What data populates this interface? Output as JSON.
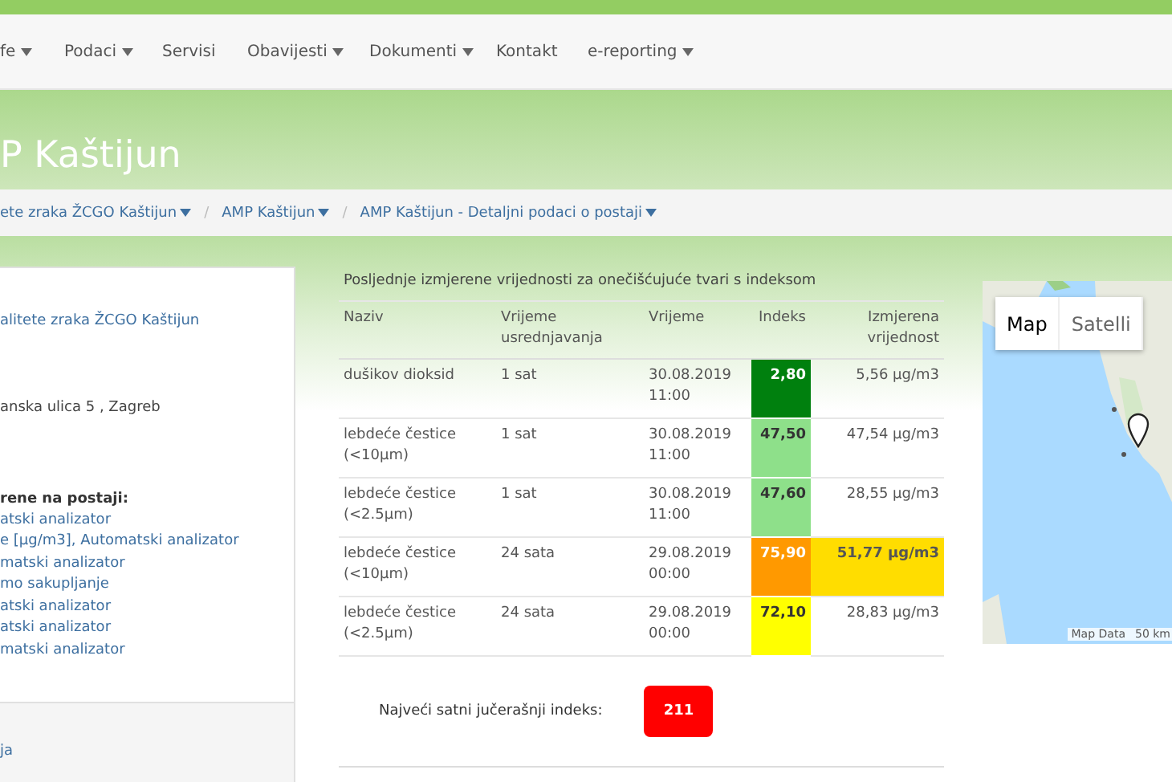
{
  "nav": [
    {
      "label": "fe",
      "dropdown": true
    },
    {
      "label": "Podaci",
      "dropdown": true
    },
    {
      "label": "Servisi",
      "dropdown": false
    },
    {
      "label": "Obavijesti",
      "dropdown": true
    },
    {
      "label": "Dokumenti",
      "dropdown": true
    },
    {
      "label": "Kontakt",
      "dropdown": false
    },
    {
      "label": "e-reporting",
      "dropdown": true
    }
  ],
  "page_title": "P Kaštijun",
  "breadcrumb": [
    {
      "label": "ete zraka ŽCGO Kaštijun"
    },
    {
      "label": "AMP Kaštijun"
    },
    {
      "label": "AMP Kaštijun - Detaljni podaci o postaji"
    }
  ],
  "breadcrumb_separator": "/",
  "info": {
    "network_link": "alitete zraka ŽCGO Kaštijun",
    "address": "anska ulica 5 , Zagreb",
    "measured_heading": "rene na postaji:",
    "measured_items": [
      "atski analizator",
      "e [µg/m3], Automatski analizator",
      "matski analizator",
      "mo sakupljanje",
      "atski analizator",
      "atski analizator",
      "matski analizator"
    ],
    "footer_link": "ja"
  },
  "table": {
    "caption": "Posljednje izmjerene vrijednosti za onečišćujuće tvari s indeksom",
    "columns": [
      "Naziv",
      "Vrijeme usrednjavanja",
      "Vrijeme",
      "Indeks",
      "Izmjerena vrijednost"
    ],
    "rows": [
      {
        "name": "dušikov dioksid",
        "averaging": "1 sat",
        "time": "30.08.2019 11:00",
        "index": "2,80",
        "color": "#00800e",
        "value": "5,56 µg/m3",
        "highlighted": false
      },
      {
        "name": "lebdeće čestice (<10µm)",
        "averaging": "1 sat",
        "time": "30.08.2019 11:00",
        "index": "47,50",
        "color": "#8ee08a",
        "value": "47,54 µg/m3",
        "highlighted": false
      },
      {
        "name": "lebdeće čestice (<2.5µm)",
        "averaging": "1 sat",
        "time": "30.08.2019 11:00",
        "index": "47,60",
        "color": "#8ee08a",
        "value": "28,55 µg/m3",
        "highlighted": false
      },
      {
        "name": "lebdeće čestice (<10µm)",
        "averaging": "24 sata",
        "time": "29.08.2019 00:00",
        "index": "75,90",
        "color": "#ff9900",
        "value": "51,77 µg/m3",
        "highlighted": true
      },
      {
        "name": "lebdeće čestice (<2.5µm)",
        "averaging": "24 sata",
        "time": "29.08.2019 00:00",
        "index": "72,10",
        "color": "#ffff00",
        "value": "28,83 µg/m3",
        "highlighted": false
      }
    ]
  },
  "max_index": {
    "label": "Najveći satni jučerašnji indeks:",
    "value": "211"
  },
  "map": {
    "types": [
      {
        "label": "Map",
        "selected": true
      },
      {
        "label": "Satelli",
        "selected": false
      }
    ],
    "attribution": "Map Data",
    "scale": "50 km"
  }
}
